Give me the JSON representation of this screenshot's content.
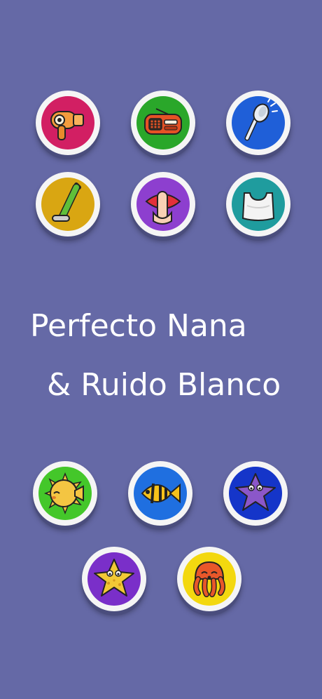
{
  "title": {
    "line1": "Perfecto Nana",
    "line2": "& Ruido Blanco"
  },
  "sound_buttons": [
    {
      "icon": "hair-dryer-icon",
      "color": "#d21f63"
    },
    {
      "icon": "radio-icon",
      "color": "#2aa72a"
    },
    {
      "icon": "shower-head-icon",
      "color": "#1f5fd8"
    },
    {
      "icon": "vacuum-cleaner-icon",
      "color": "#d9a612"
    },
    {
      "icon": "shush-lips-icon",
      "color": "#8d3fcf"
    },
    {
      "icon": "plastic-bag-icon",
      "color": "#1f9c9e"
    }
  ],
  "lullaby_buttons": [
    {
      "icon": "pufferfish-icon",
      "color": "#44c72a"
    },
    {
      "icon": "striped-fish-icon",
      "color": "#1f6fe0"
    },
    {
      "icon": "purple-starfish-icon",
      "color": "#1535c9"
    },
    {
      "icon": "yellow-starfish-icon",
      "color": "#7a2fc9"
    },
    {
      "icon": "octopus-icon",
      "color": "#f3d80f"
    }
  ]
}
